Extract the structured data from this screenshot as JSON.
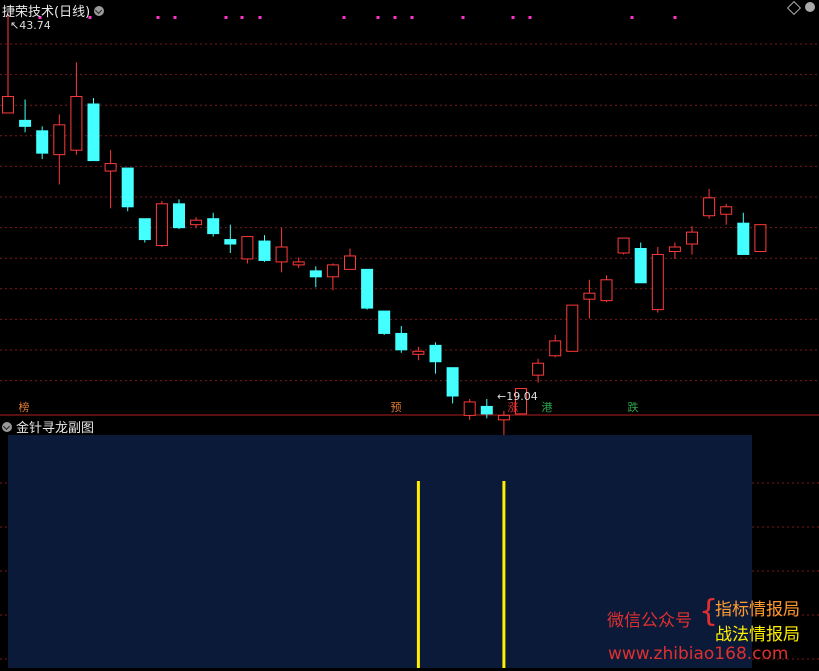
{
  "upper_panel": {
    "title": "捷荣技术(日线)"
  },
  "lower_panel": {
    "title": "金针寻龙副图"
  },
  "labels": {
    "high": "43.74",
    "low": "19.04"
  },
  "markers": [
    {
      "text": "榜",
      "color": "#e07a30"
    },
    {
      "text": "预",
      "color": "#e07a30"
    },
    {
      "text": "涨",
      "color": "#e03030"
    },
    {
      "text": "港",
      "color": "#2aa84a"
    },
    {
      "text": "跌",
      "color": "#2aa84a"
    }
  ],
  "watermark": {
    "wechat": "微信公众号",
    "line1": "指标情报局",
    "line2": "战法情报局",
    "url": "www.zhibiao168.com"
  },
  "colors": {
    "up": "#ff3a3a",
    "down": "#44ffff",
    "signal": "#ffee00",
    "panel_bg": "#0a1a38",
    "dot": "#ff33cc"
  },
  "chart_data": {
    "type": "candlestick",
    "price_range": [
      19.04,
      43.74
    ],
    "candles": [
      {
        "o": 38.2,
        "h": 43.74,
        "c": 37.1,
        "l": 37.1,
        "d": "up"
      },
      {
        "o": 36.6,
        "h": 38.0,
        "c": 36.2,
        "l": 35.8,
        "d": "down"
      },
      {
        "o": 35.9,
        "h": 36.2,
        "c": 34.4,
        "l": 34.0,
        "d": "down"
      },
      {
        "o": 34.3,
        "h": 37.0,
        "c": 36.3,
        "l": 32.3,
        "d": "up"
      },
      {
        "o": 34.6,
        "h": 40.5,
        "c": 38.2,
        "l": 34.3,
        "d": "up"
      },
      {
        "o": 37.7,
        "h": 38.1,
        "c": 33.9,
        "l": 33.9,
        "d": "down"
      },
      {
        "o": 33.2,
        "h": 34.6,
        "c": 33.7,
        "l": 30.7,
        "d": "up"
      },
      {
        "o": 33.4,
        "h": 33.4,
        "c": 30.8,
        "l": 30.5,
        "d": "down"
      },
      {
        "o": 30.0,
        "h": 30.0,
        "c": 28.6,
        "l": 28.4,
        "d": "down"
      },
      {
        "o": 28.2,
        "h": 31.2,
        "c": 31.0,
        "l": 28.1,
        "d": "up"
      },
      {
        "o": 31.0,
        "h": 31.3,
        "c": 29.4,
        "l": 29.3,
        "d": "down"
      },
      {
        "o": 29.6,
        "h": 30.1,
        "c": 29.9,
        "l": 29.4,
        "d": "up"
      },
      {
        "o": 30.0,
        "h": 30.4,
        "c": 29.0,
        "l": 28.8,
        "d": "down"
      },
      {
        "o": 28.6,
        "h": 29.6,
        "c": 28.3,
        "l": 27.7,
        "d": "down"
      },
      {
        "o": 27.3,
        "h": 28.8,
        "c": 28.8,
        "l": 27.0,
        "d": "up"
      },
      {
        "o": 28.5,
        "h": 28.9,
        "c": 27.2,
        "l": 27.1,
        "d": "down"
      },
      {
        "o": 27.1,
        "h": 29.4,
        "c": 28.1,
        "l": 26.4,
        "d": "up"
      },
      {
        "o": 27.1,
        "h": 27.4,
        "c": 26.9,
        "l": 26.7,
        "d": "up"
      },
      {
        "o": 26.5,
        "h": 26.8,
        "c": 26.1,
        "l": 25.4,
        "d": "down"
      },
      {
        "o": 26.1,
        "h": 27.0,
        "c": 26.9,
        "l": 25.2,
        "d": "up"
      },
      {
        "o": 26.6,
        "h": 28.0,
        "c": 27.5,
        "l": 26.6,
        "d": "up"
      },
      {
        "o": 26.6,
        "h": 26.6,
        "c": 24.0,
        "l": 23.9,
        "d": "down"
      },
      {
        "o": 23.8,
        "h": 23.8,
        "c": 22.3,
        "l": 22.2,
        "d": "down"
      },
      {
        "o": 22.3,
        "h": 22.8,
        "c": 21.2,
        "l": 21.0,
        "d": "down"
      },
      {
        "o": 21.1,
        "h": 21.4,
        "c": 20.9,
        "l": 20.5,
        "d": "up"
      },
      {
        "o": 21.5,
        "h": 21.7,
        "c": 20.4,
        "l": 19.6,
        "d": "down"
      },
      {
        "o": 20.0,
        "h": 20.0,
        "c": 18.1,
        "l": 17.6,
        "d": "down"
      },
      {
        "o": 16.8,
        "h": 17.9,
        "c": 17.7,
        "l": 16.5,
        "d": "up"
      },
      {
        "o": 17.4,
        "h": 17.9,
        "c": 16.9,
        "l": 16.6,
        "d": "down"
      },
      {
        "o": 16.8,
        "h": 17.1,
        "c": 16.5,
        "l": 15.0,
        "d": "up"
      },
      {
        "o": 16.9,
        "h": 18.6,
        "c": 18.6,
        "l": 16.9,
        "d": "up"
      },
      {
        "o": 19.5,
        "h": 20.6,
        "c": 20.3,
        "l": 19.0,
        "d": "up"
      },
      {
        "o": 20.8,
        "h": 22.2,
        "c": 21.8,
        "l": 20.7,
        "d": "up"
      },
      {
        "o": 21.1,
        "h": 24.2,
        "c": 24.2,
        "l": 21.1,
        "d": "up"
      },
      {
        "o": 24.6,
        "h": 25.9,
        "c": 25.0,
        "l": 23.3,
        "d": "up"
      },
      {
        "o": 24.5,
        "h": 26.2,
        "c": 25.9,
        "l": 24.4,
        "d": "up"
      },
      {
        "o": 27.7,
        "h": 28.6,
        "c": 28.7,
        "l": 27.6,
        "d": "up"
      },
      {
        "o": 28.0,
        "h": 28.4,
        "c": 25.7,
        "l": 25.7,
        "d": "down"
      },
      {
        "o": 23.9,
        "h": 28.1,
        "c": 27.6,
        "l": 23.7,
        "d": "up"
      },
      {
        "o": 27.8,
        "h": 28.4,
        "c": 28.1,
        "l": 27.3,
        "d": "up"
      },
      {
        "o": 28.3,
        "h": 29.5,
        "c": 29.1,
        "l": 27.6,
        "d": "up"
      },
      {
        "o": 30.2,
        "h": 32.0,
        "c": 31.4,
        "l": 30.0,
        "d": "up"
      },
      {
        "o": 30.8,
        "h": 31.0,
        "c": 30.3,
        "l": 29.6,
        "d": "up"
      },
      {
        "o": 29.7,
        "h": 30.4,
        "c": 27.6,
        "l": 27.6,
        "d": "down"
      },
      {
        "o": 27.8,
        "h": 29.6,
        "c": 29.6,
        "l": 27.8,
        "d": "up"
      }
    ],
    "signal_bars": [
      24,
      29
    ]
  }
}
